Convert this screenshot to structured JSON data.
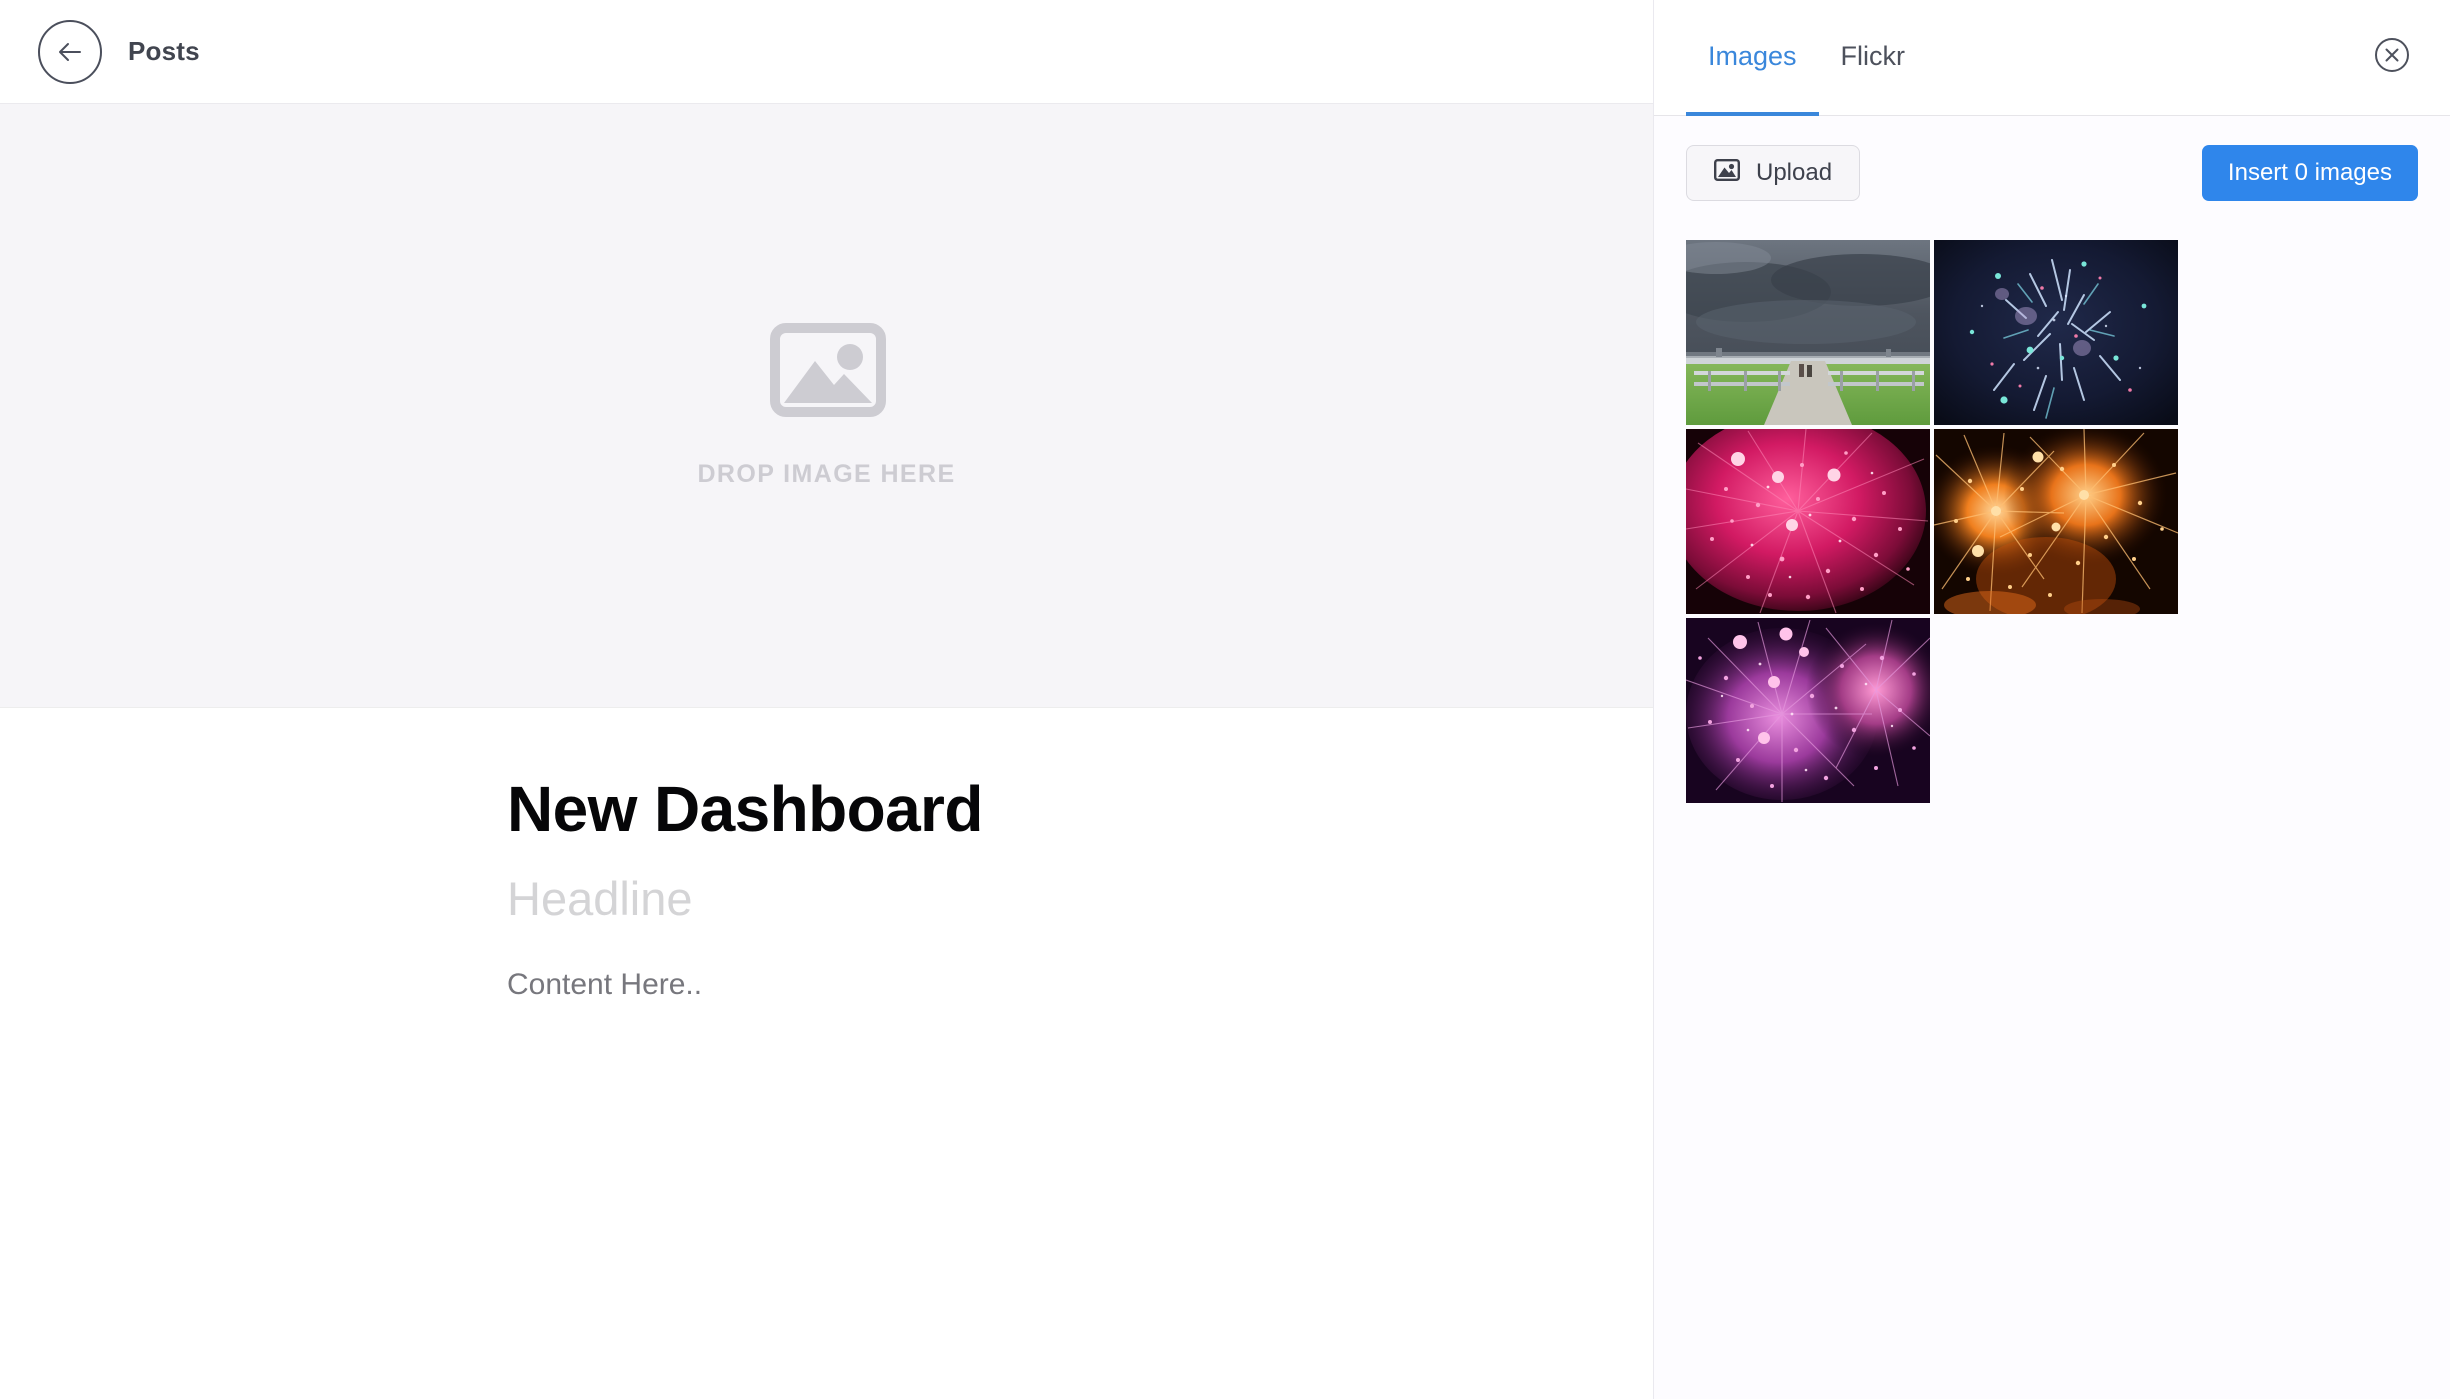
{
  "editor": {
    "back_icon": "arrow-left-icon",
    "title": "Posts",
    "dropzone": {
      "icon": "image-placeholder-icon",
      "label": "DROP IMAGE HERE"
    },
    "document": {
      "title": "New Dashboard",
      "headline_placeholder": "Headline",
      "content": "Content Here.."
    }
  },
  "panel": {
    "tabs": [
      {
        "label": "Images",
        "active": true
      },
      {
        "label": "Flickr",
        "active": false
      }
    ],
    "close_icon": "close-circle-icon",
    "toolbar": {
      "upload_icon": "image-icon",
      "upload_label": "Upload",
      "insert_label": "Insert 0 images",
      "insert_count": 0
    },
    "thumbnails": [
      {
        "name": "stormy-sky-over-fields-road",
        "alt": "Dark storm clouds over green rice fields with a road"
      },
      {
        "name": "blue-teal-fireworks",
        "alt": "Dark blue and teal fireworks sparks"
      },
      {
        "name": "pink-fireworks-burst",
        "alt": "Bright pink fireworks burst"
      },
      {
        "name": "orange-fireworks-burst",
        "alt": "Orange fireworks bursts"
      },
      {
        "name": "purple-fireworks-burst",
        "alt": "Purple and magenta fireworks burst"
      }
    ]
  },
  "colors": {
    "accent": "#2f86eb",
    "tab_active": "#3a87db",
    "dropzone_bg": "#f6f5f8",
    "panel_bg": "#fdfcff",
    "title_text": "#060608",
    "placeholder_text": "#d4d4d6"
  }
}
